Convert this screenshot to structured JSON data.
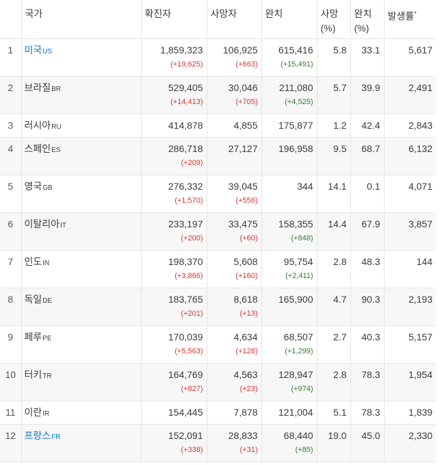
{
  "header": {
    "rank": "",
    "country": "국가",
    "confirmed": "확진자",
    "deaths": "사망자",
    "recovered": "완치",
    "death_rate_line1": "사망",
    "death_rate_line2": "(%)",
    "recovery_rate_line1": "완치",
    "recovery_rate_line2": "(%)",
    "incidence": "발생률",
    "incidence_mark": "*"
  },
  "rows": [
    {
      "rank": "1",
      "name": "미국",
      "code": "US",
      "link": true,
      "confirmed": "1,859,323",
      "confirmed_delta": "(+19,625)",
      "deaths": "106,925",
      "deaths_delta": "(+663)",
      "recovered": "615,416",
      "recovered_delta": "(+15,491)",
      "death_rate": "5.8",
      "recovery_rate": "33.1",
      "incidence": "5,617"
    },
    {
      "rank": "2",
      "name": "브라질",
      "code": "BR",
      "link": false,
      "confirmed": "529,405",
      "confirmed_delta": "(+14,413)",
      "deaths": "30,046",
      "deaths_delta": "(+705)",
      "recovered": "211,080",
      "recovered_delta": "(+4,525)",
      "death_rate": "5.7",
      "recovery_rate": "39.9",
      "incidence": "2,491"
    },
    {
      "rank": "3",
      "name": "러시아",
      "code": "RU",
      "link": false,
      "confirmed": "414,878",
      "confirmed_delta": "",
      "deaths": "4,855",
      "deaths_delta": "",
      "recovered": "175,877",
      "recovered_delta": "",
      "death_rate": "1.2",
      "recovery_rate": "42.4",
      "incidence": "2,843"
    },
    {
      "rank": "4",
      "name": "스페인",
      "code": "ES",
      "link": false,
      "confirmed": "286,718",
      "confirmed_delta": "(+209)",
      "deaths": "27,127",
      "deaths_delta": "",
      "recovered": "196,958",
      "recovered_delta": "",
      "death_rate": "9.5",
      "recovery_rate": "68.7",
      "incidence": "6,132"
    },
    {
      "rank": "5",
      "name": "영국",
      "code": "GB",
      "link": false,
      "confirmed": "276,332",
      "confirmed_delta": "(+1,570)",
      "deaths": "39,045",
      "deaths_delta": "(+556)",
      "recovered": "344",
      "recovered_delta": "",
      "death_rate": "14.1",
      "recovery_rate": "0.1",
      "incidence": "4,071"
    },
    {
      "rank": "6",
      "name": "이탈리아",
      "code": "IT",
      "link": false,
      "confirmed": "233,197",
      "confirmed_delta": "(+200)",
      "deaths": "33,475",
      "deaths_delta": "(+60)",
      "recovered": "158,355",
      "recovered_delta": "(+848)",
      "death_rate": "14.4",
      "recovery_rate": "67.9",
      "incidence": "3,857"
    },
    {
      "rank": "7",
      "name": "인도",
      "code": "IN",
      "link": false,
      "confirmed": "198,370",
      "confirmed_delta": "(+3,866)",
      "deaths": "5,608",
      "deaths_delta": "(+160)",
      "recovered": "95,754",
      "recovered_delta": "(+2,411)",
      "death_rate": "2.8",
      "recovery_rate": "48.3",
      "incidence": "144"
    },
    {
      "rank": "8",
      "name": "독일",
      "code": "DE",
      "link": false,
      "confirmed": "183,765",
      "confirmed_delta": "(+201)",
      "deaths": "8,618",
      "deaths_delta": "(+13)",
      "recovered": "165,900",
      "recovered_delta": "",
      "death_rate": "4.7",
      "recovery_rate": "90.3",
      "incidence": "2,193"
    },
    {
      "rank": "9",
      "name": "페루",
      "code": "PE",
      "link": false,
      "confirmed": "170,039",
      "confirmed_delta": "(+5,563)",
      "deaths": "4,634",
      "deaths_delta": "(+128)",
      "recovered": "68,507",
      "recovered_delta": "(+1,299)",
      "death_rate": "2.7",
      "recovery_rate": "40.3",
      "incidence": "5,157"
    },
    {
      "rank": "10",
      "name": "터키",
      "code": "TR",
      "link": false,
      "confirmed": "164,769",
      "confirmed_delta": "(+827)",
      "deaths": "4,563",
      "deaths_delta": "(+23)",
      "recovered": "128,947",
      "recovered_delta": "(+974)",
      "death_rate": "2.8",
      "recovery_rate": "78.3",
      "incidence": "1,954"
    },
    {
      "rank": "11",
      "name": "이란",
      "code": "IR",
      "link": false,
      "confirmed": "154,445",
      "confirmed_delta": "",
      "deaths": "7,878",
      "deaths_delta": "",
      "recovered": "121,004",
      "recovered_delta": "",
      "death_rate": "5.1",
      "recovery_rate": "78.3",
      "incidence": "1,839"
    },
    {
      "rank": "12",
      "name": "프랑스",
      "code": "FR",
      "link": true,
      "confirmed": "152,091",
      "confirmed_delta": "(+338)",
      "deaths": "28,833",
      "deaths_delta": "(+31)",
      "recovered": "68,440",
      "recovered_delta": "(+85)",
      "death_rate": "19.0",
      "recovery_rate": "45.0",
      "incidence": "2,330"
    }
  ]
}
